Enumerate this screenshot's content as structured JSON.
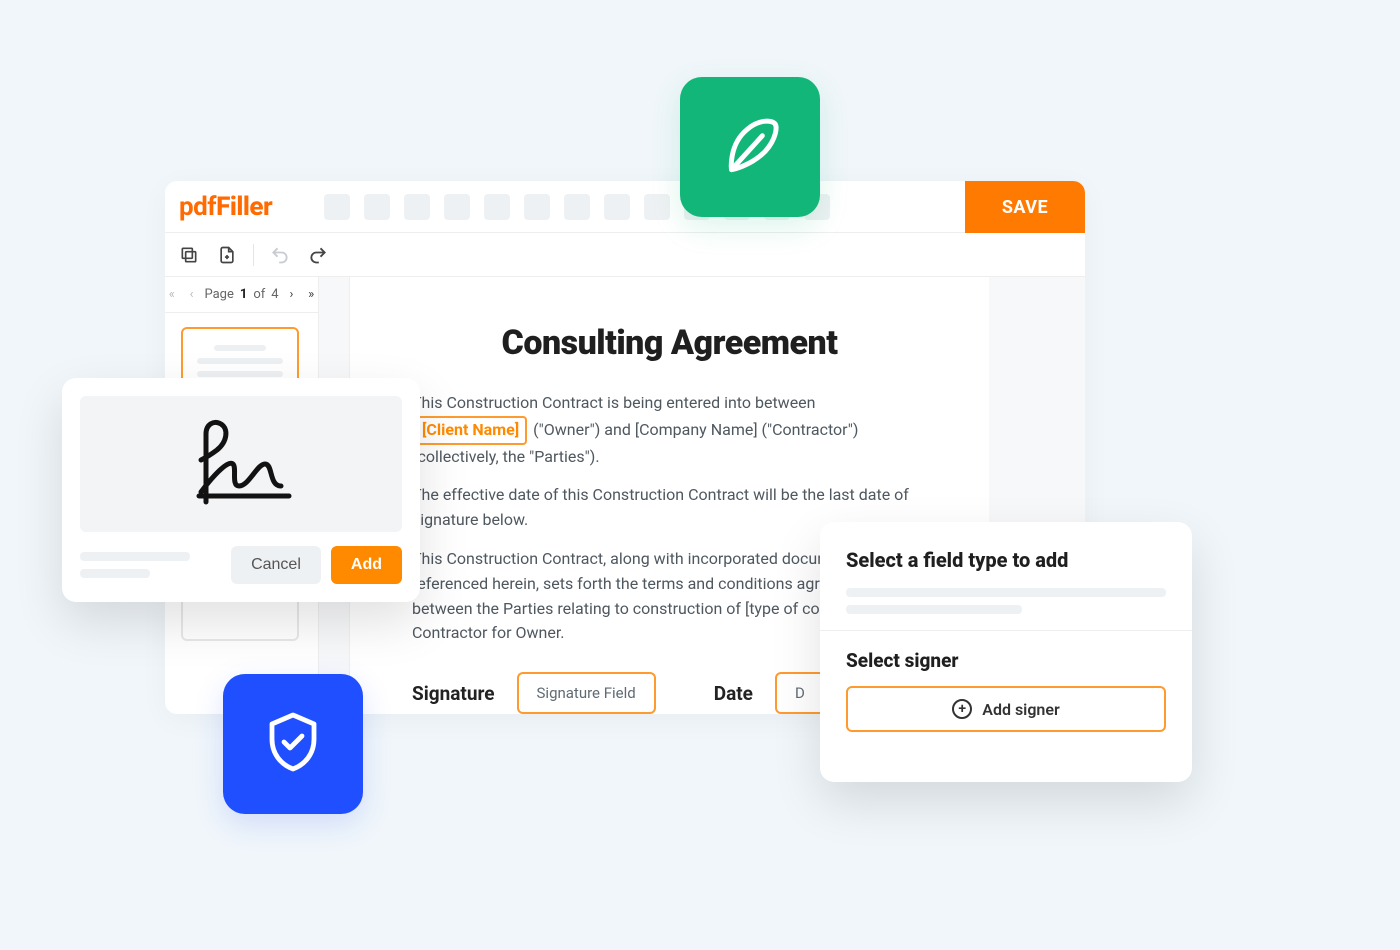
{
  "brand": {
    "prefix": "pdf",
    "suffix": "Filler"
  },
  "toolbar": {
    "save_label": "SAVE"
  },
  "pager": {
    "prefix": "Page",
    "current": "1",
    "of_word": "of",
    "total": "4"
  },
  "document": {
    "title": "Consulting Agreement",
    "para1_a": "This Construction Contract is being entered into between ",
    "client_token": "[Client Name]",
    "para1_b": " (\"Owner\") and  [Company Name]  (\"Contractor\") (collectively, the \"Parties\").",
    "para2": "The effective date of this Construction Contract will be the last date of signature below.",
    "para3": "This Construction Contract, along with incorporated documents referenced herein, sets forth the terms and conditions agreed to between the Parties relating to construction of [type of construction] by Contractor for Owner.",
    "signature_label": "Signature",
    "signature_field": "Signature Field",
    "date_label": "Date",
    "date_field_partial": "D"
  },
  "sig_popup": {
    "cancel": "Cancel",
    "add": "Add"
  },
  "field_popup": {
    "title": "Select a field type to add",
    "subtitle": "Select signer",
    "add_signer": "Add signer"
  }
}
